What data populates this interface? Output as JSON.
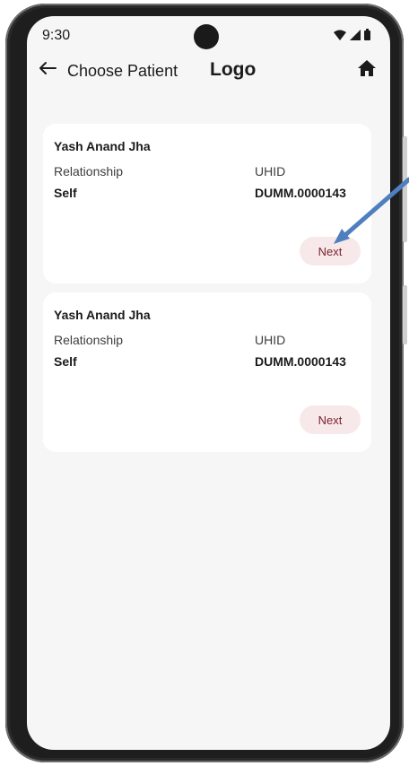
{
  "status_bar": {
    "time": "9:30",
    "icons": [
      "wifi-icon",
      "signal-icon",
      "battery-icon"
    ]
  },
  "header": {
    "back_icon": "arrow-left-icon",
    "title": "Choose Patient",
    "logo": "Logo",
    "home_icon": "home-icon"
  },
  "patients": [
    {
      "name": "Yash Anand Jha",
      "relationship_label": "Relationship",
      "relationship": "Self",
      "uhid_label": "UHID",
      "uhid": "DUMM.0000143",
      "next_label": "Next"
    },
    {
      "name": "Yash Anand Jha",
      "relationship_label": "Relationship",
      "relationship": "Self",
      "uhid_label": "UHID",
      "uhid": "DUMM.0000143",
      "next_label": "Next"
    }
  ],
  "colors": {
    "screen_bg": "#f6f6f6",
    "card_bg": "#ffffff",
    "next_button_bg": "#f7e9ea",
    "next_button_text": "#7a1e28",
    "annotation_arrow": "#4f7fbf"
  }
}
